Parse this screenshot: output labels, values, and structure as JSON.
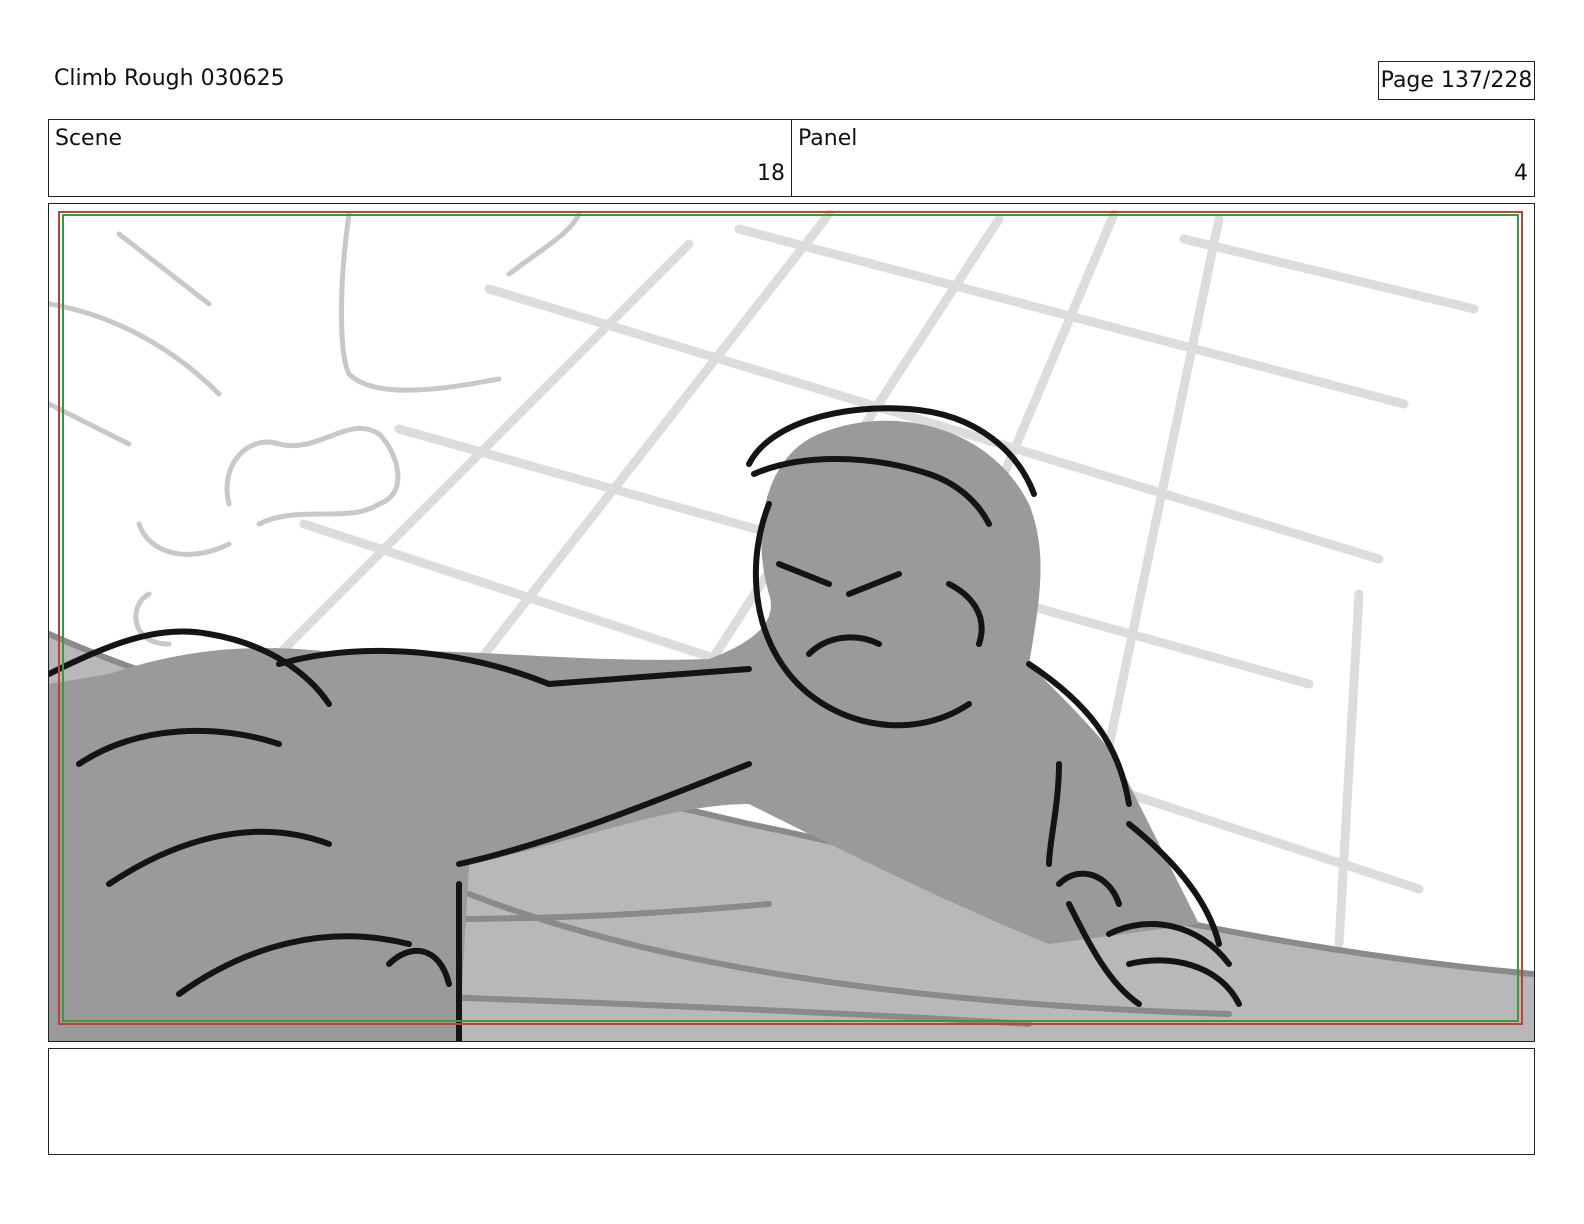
{
  "document": {
    "title": "Climb Rough 030625",
    "page_indicator": "Page 137/228"
  },
  "info": {
    "scene_label": "Scene",
    "scene_value": "18",
    "panel_label": "Panel",
    "panel_value": "4"
  },
  "panel": {
    "drawing_icon": "storyboard-sketch",
    "guide_colors": {
      "outer": "#c04040",
      "inner": "#3a9a3a"
    },
    "fill_colors": {
      "figure": "#9a9a9a",
      "ledge": "#b8b8b8",
      "lines": "#141414",
      "background": "#dcdcdc"
    }
  },
  "notes": {
    "text": ""
  }
}
